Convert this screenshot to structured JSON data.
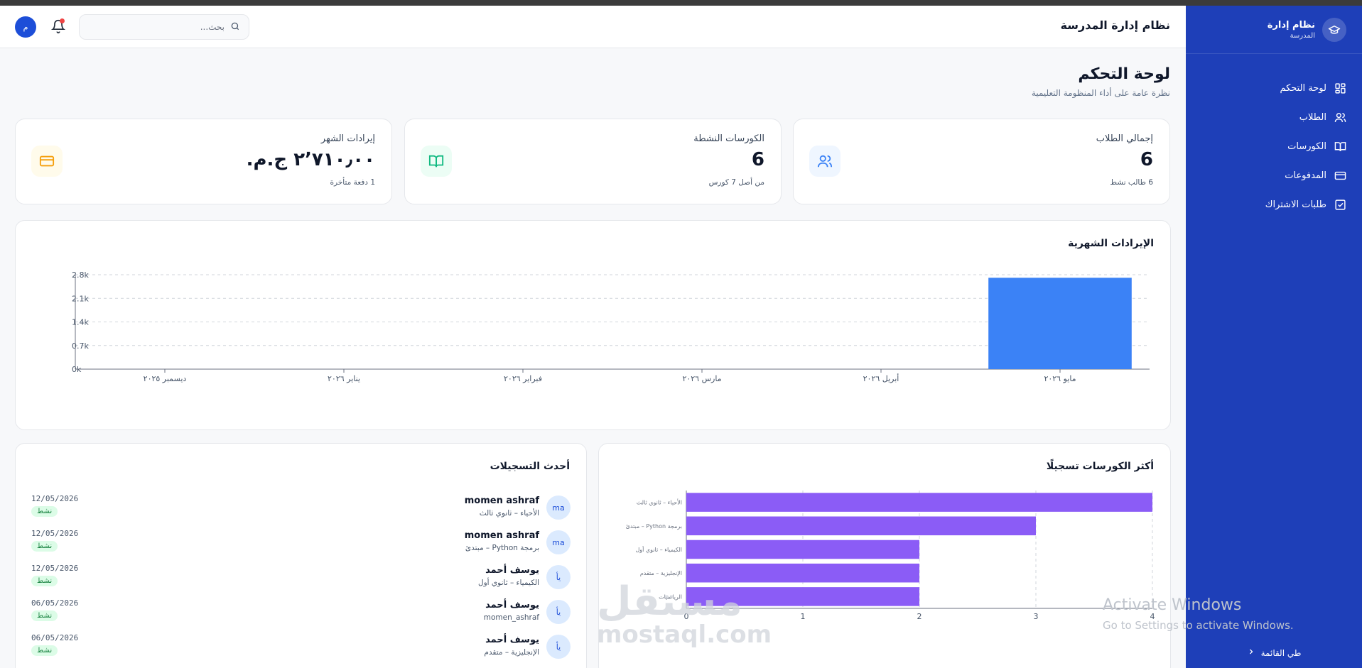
{
  "app": {
    "title": "نظام إدارة المدرسة",
    "brand_line1": "نظام إدارة",
    "brand_line2": "المدرسة",
    "avatar_initial": "م"
  },
  "search": {
    "placeholder": "بحث..."
  },
  "sidebar": {
    "items": [
      {
        "label": "لوحة التحكم",
        "icon": "dashboard-grid-icon"
      },
      {
        "label": "الطلاب",
        "icon": "users-icon"
      },
      {
        "label": "الكورسات",
        "icon": "book-open-icon"
      },
      {
        "label": "المدفوعات",
        "icon": "credit-card-icon"
      },
      {
        "label": "طلبات الاشتراك",
        "icon": "checkbox-icon"
      }
    ],
    "collapse_label": "طي القائمة"
  },
  "page": {
    "title": "لوحة التحكم",
    "subtitle": "نظرة عامة على أداء المنظومة التعليمية"
  },
  "stats": [
    {
      "label": "إجمالي الطلاب",
      "value": "6",
      "note": "6 طالب نشط",
      "icon": "users-icon",
      "color": "#3b82f6"
    },
    {
      "label": "الكورسات النشطة",
      "value": "6",
      "note": "من أصل 7 كورس",
      "icon": "book-open-icon",
      "color": "#10b981"
    },
    {
      "label": "إيرادات الشهر",
      "value": "٢٬٧١٠٫٠٠ ج.م.",
      "note": "1 دفعة متأخرة",
      "icon": "credit-card-icon",
      "color": "#f59e0b"
    }
  ],
  "revenue_card": {
    "title": "الإيرادات الشهرية"
  },
  "top_courses_card": {
    "title": "أكثر الكورسات تسجيلًا"
  },
  "recent_card": {
    "title": "أحدث التسجيلات",
    "rows": [
      {
        "initials": "ma",
        "name": "momen ashraf",
        "course": "الأحياء – ثانوي ثالث",
        "date": "12/05/2026",
        "status": "نشط"
      },
      {
        "initials": "ma",
        "name": "momen ashraf",
        "course": "برمجة Python – مبتدئ",
        "date": "12/05/2026",
        "status": "نشط"
      },
      {
        "initials": "يأ",
        "name": "يوسف أحمد",
        "course": "الكيمياء – ثانوي أول",
        "date": "12/05/2026",
        "status": "نشط"
      },
      {
        "initials": "يأ",
        "name": "يوسف أحمد",
        "course": "momen_ashraf",
        "date": "06/05/2026",
        "status": "نشط"
      },
      {
        "initials": "يأ",
        "name": "يوسف أحمد",
        "course": "الإنجليزية – متقدم",
        "date": "06/05/2026",
        "status": "نشط"
      }
    ]
  },
  "chart_data": [
    {
      "type": "bar",
      "categories": [
        "ديسمبر ٢٠٢٥",
        "يناير ٢٠٢٦",
        "فبراير ٢٠٢٦",
        "مارس ٢٠٢٦",
        "أبريل ٢٠٢٦",
        "مايو ٢٠٢٦"
      ],
      "values": [
        0,
        0,
        0,
        0,
        0,
        2710
      ],
      "y_ticks": [
        "0k",
        "0.7k",
        "1.4k",
        "2.1k",
        "2.8k"
      ],
      "ylim": [
        0,
        2800
      ],
      "color": "#3b82f6",
      "grid": true
    },
    {
      "type": "bar",
      "orientation": "horizontal",
      "categories": [
        "الأحياء – ثانوي ثالث",
        "برمجة Python – مبتدئ",
        "الكيمياء – ثانوي أول",
        "الإنجليزية – متقدم",
        "الرياضيات"
      ],
      "values": [
        4,
        3,
        2,
        2,
        2
      ],
      "x_ticks": [
        "0",
        "1",
        "2",
        "3",
        "4"
      ],
      "xlim": [
        0,
        4
      ],
      "color": "#8b5cf6",
      "grid": true
    }
  ],
  "watermarks": {
    "windows_line1": "Activate Windows",
    "windows_line2": "Go to Settings to activate Windows.",
    "mostaql_ar": "مستقل",
    "mostaql_en": "mostaql.com"
  }
}
